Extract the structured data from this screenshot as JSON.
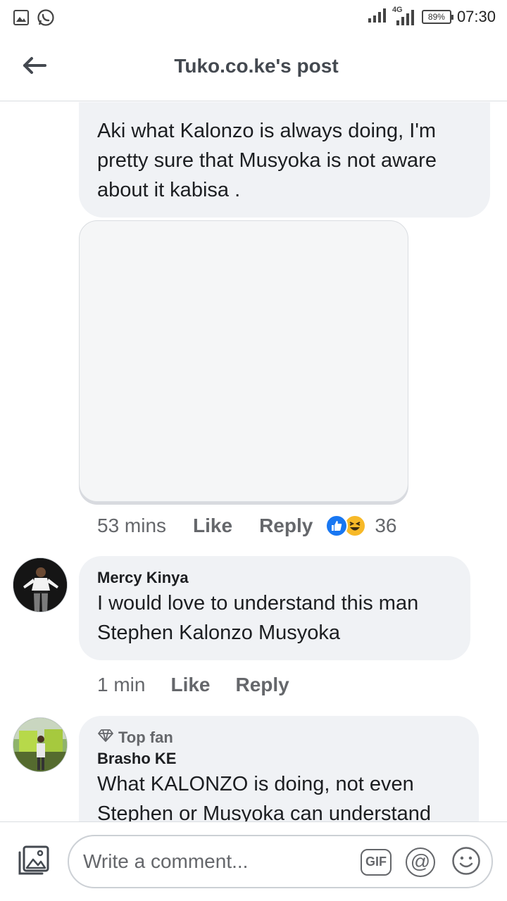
{
  "status_bar": {
    "network": "4G",
    "battery": "89%",
    "time": "07:30",
    "icons": [
      "gallery-icon",
      "whatsapp-icon",
      "signal-icon",
      "signal-4g-icon",
      "battery-icon"
    ]
  },
  "header": {
    "title": "Tuko.co.ke's post",
    "back_icon": "arrow-left-icon"
  },
  "comments": [
    {
      "text": "Aki what Kalonzo is always doing, I'm pretty sure that Musyoka is not aware about it kabisa           .",
      "time": "53 mins",
      "like_label": "Like",
      "reply_label": "Reply",
      "reactions": [
        "like",
        "haha"
      ],
      "reaction_count": "36"
    },
    {
      "author": "Mercy Kinya",
      "text": "I would love to understand this man Stephen Kalonzo Musyoka",
      "time": "1 min",
      "like_label": "Like",
      "reply_label": "Reply"
    },
    {
      "badge": "Top fan",
      "author": "Brasho KE",
      "text": "What KALONZO is doing, not even Stephen or Musyoka can understand"
    }
  ],
  "composer": {
    "placeholder": "Write a comment...",
    "gif_label": "GIF",
    "at_label": "@"
  },
  "colors": {
    "bubble": "#f0f2f5",
    "secondary_text": "#65676b",
    "like_blue": "#1877f2",
    "haha_yellow": "#f7b928"
  }
}
